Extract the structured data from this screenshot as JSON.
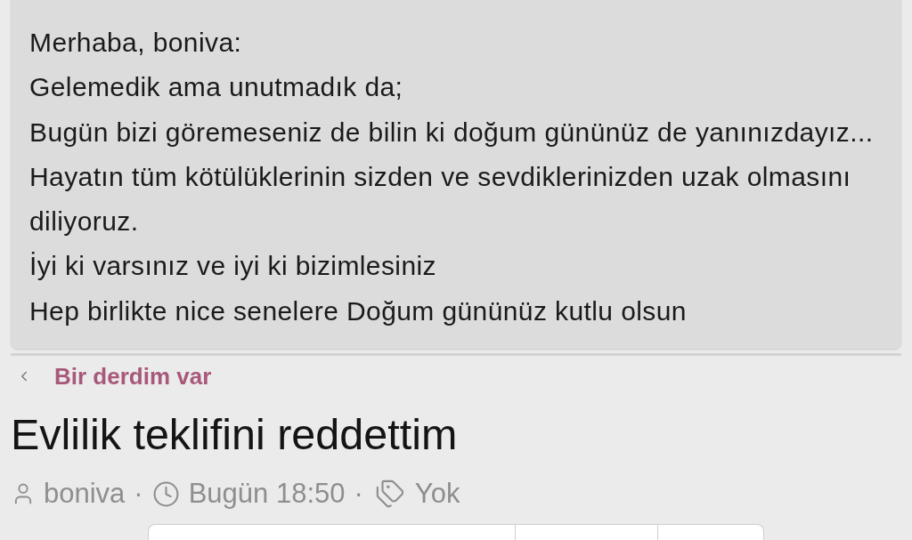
{
  "message": {
    "paragraphs": [
      "Merhaba, boniva:",
      "Gelemedik ama unutmadık da;",
      "Bugün bizi göremeseniz de bilin ki doğum gününüz de yanınızdayız...",
      "Hayatın tüm kötülüklerinin sizden ve sevdiklerinizden uzak olmasını diliyoruz.",
      "İyi ki varsınız ve iyi ki bizimlesiniz",
      "Hep birlikte nice senelere Doğum gününüz kutlu olsun"
    ]
  },
  "breadcrumb": {
    "label": "Bir derdim var"
  },
  "thread": {
    "title": "Evlilik teklifini reddettim",
    "meta": [
      {
        "kind": "author",
        "text": "boniva"
      },
      {
        "kind": "separator",
        "text": "·"
      },
      {
        "kind": "time",
        "text": "Bugün 18:50"
      },
      {
        "kind": "separator",
        "text": "·"
      },
      {
        "kind": "tags",
        "text": "Yok"
      }
    ]
  }
}
